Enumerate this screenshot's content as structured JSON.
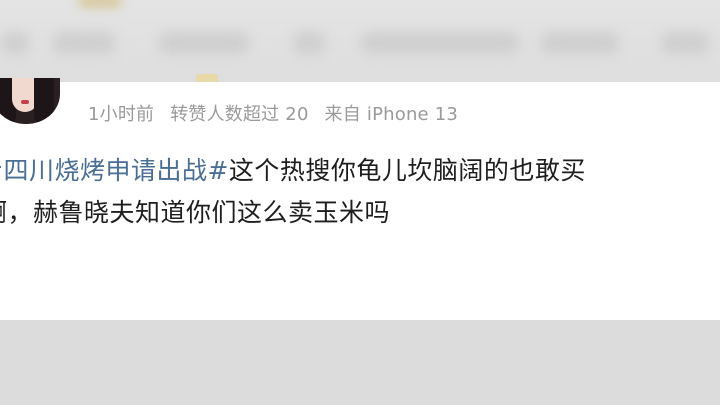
{
  "post": {
    "time": "1小时前",
    "reposts": "转赞人数超过 20",
    "source": "来自 iPhone 13",
    "hashtag": "#四川烧烤申请出战#",
    "text_line1_rest": "这个热搜你龟儿坎脑阔的也敢买",
    "text_line2": "啊，赫鲁晓夫知道你们这么卖玉米吗"
  },
  "colors": {
    "hashtag": "#4a6e94",
    "meta": "#9a9a9a",
    "background": "#dcdcdc",
    "card": "#ffffff"
  }
}
